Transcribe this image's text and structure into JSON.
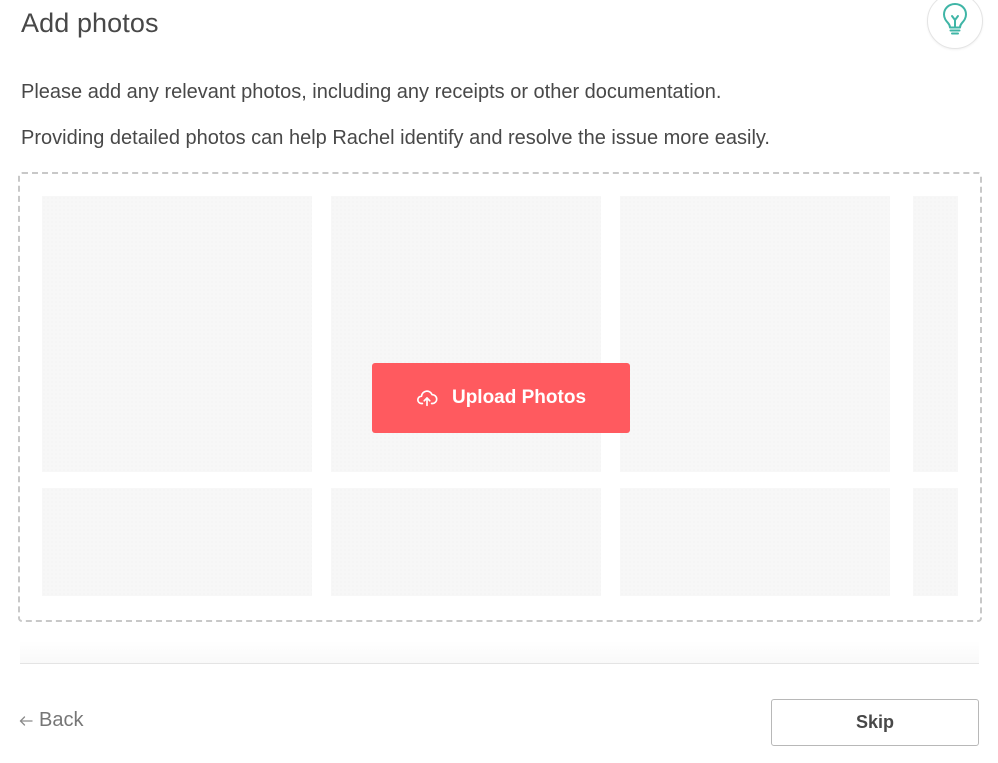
{
  "header": {
    "title": "Add photos",
    "tip_icon": "lightbulb-icon"
  },
  "instructions": {
    "line1": "Please add any relevant photos, including any receipts or other documentation.",
    "line2": "Providing detailed photos can help Rachel identify and resolve the issue more easily."
  },
  "dropzone": {
    "upload_label": "Upload Photos",
    "upload_icon": "cloud-upload-icon"
  },
  "footer": {
    "back_label": "Back",
    "back_icon": "arrow-left-icon",
    "skip_label": "Skip"
  },
  "colors": {
    "accent": "#ff5a5f",
    "tip_icon": "#3fb5a6",
    "text": "#484848"
  }
}
